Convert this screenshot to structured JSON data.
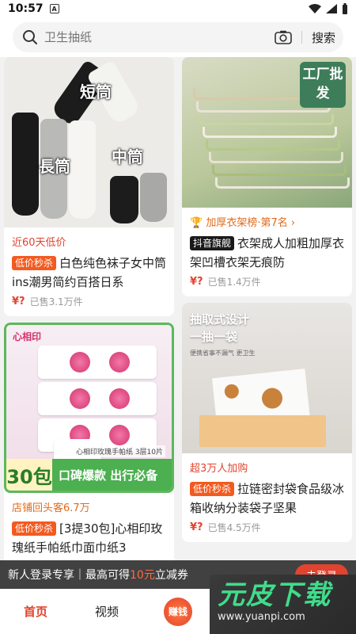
{
  "status_bar": {
    "time": "10:57",
    "notification": "A"
  },
  "search": {
    "placeholder": "卫生抽纸",
    "button": "搜索",
    "icon": "search-icon",
    "camera_icon": "camera-icon"
  },
  "products": {
    "socks": {
      "image_labels": [
        "短筒",
        "長筒",
        "中筒"
      ],
      "tagline": "近60天低价",
      "badge": "低价秒杀",
      "title": "白色纯色袜子女中筒ins潮男简约百搭日系",
      "yen": "¥?",
      "sold": "已售3.1万件"
    },
    "hangers": {
      "stamp": "工厂批发",
      "tagline": "加厚衣架榜·第7名",
      "badge": "抖音旗舰",
      "title": "衣架成人加粗加厚衣架凹槽衣架无痕防",
      "yen": "¥?",
      "sold": "已售1.4万件"
    },
    "tissues": {
      "brand": "心相印",
      "count": "30包",
      "slogan": "口碑爆款 出行必备",
      "spec": "心相印玫瑰手帕纸 3层10片",
      "tagline": "店铺回头客6.7万",
      "badge": "低价秒杀",
      "title": "[3提30包]心相印玫瑰纸手帕纸巾面巾纸3"
    },
    "bags": {
      "headline_1": "抽取式设计",
      "headline_2": "一抽一袋",
      "subline": "便携省事不漏气 更卫生",
      "tagline": "超3万人加购",
      "badge": "低价秒杀",
      "title": "拉链密封袋食品级冰箱收纳分装袋子坚果",
      "yen": "¥?",
      "sold": "已售4.5万件"
    }
  },
  "promo": {
    "text_a": "新人登录专享｜最高可得",
    "amount": "10元",
    "text_b": "立减券",
    "button": "去登录"
  },
  "bottom_nav": {
    "home": "首页",
    "video": "视频",
    "earn": "赚钱"
  },
  "watermark": {
    "title": "元皮下载",
    "url": "www.yuanpi.com"
  },
  "colors": {
    "accent": "#e2432f",
    "badge": "#f35a1f",
    "nav_active": "#e2432f"
  }
}
